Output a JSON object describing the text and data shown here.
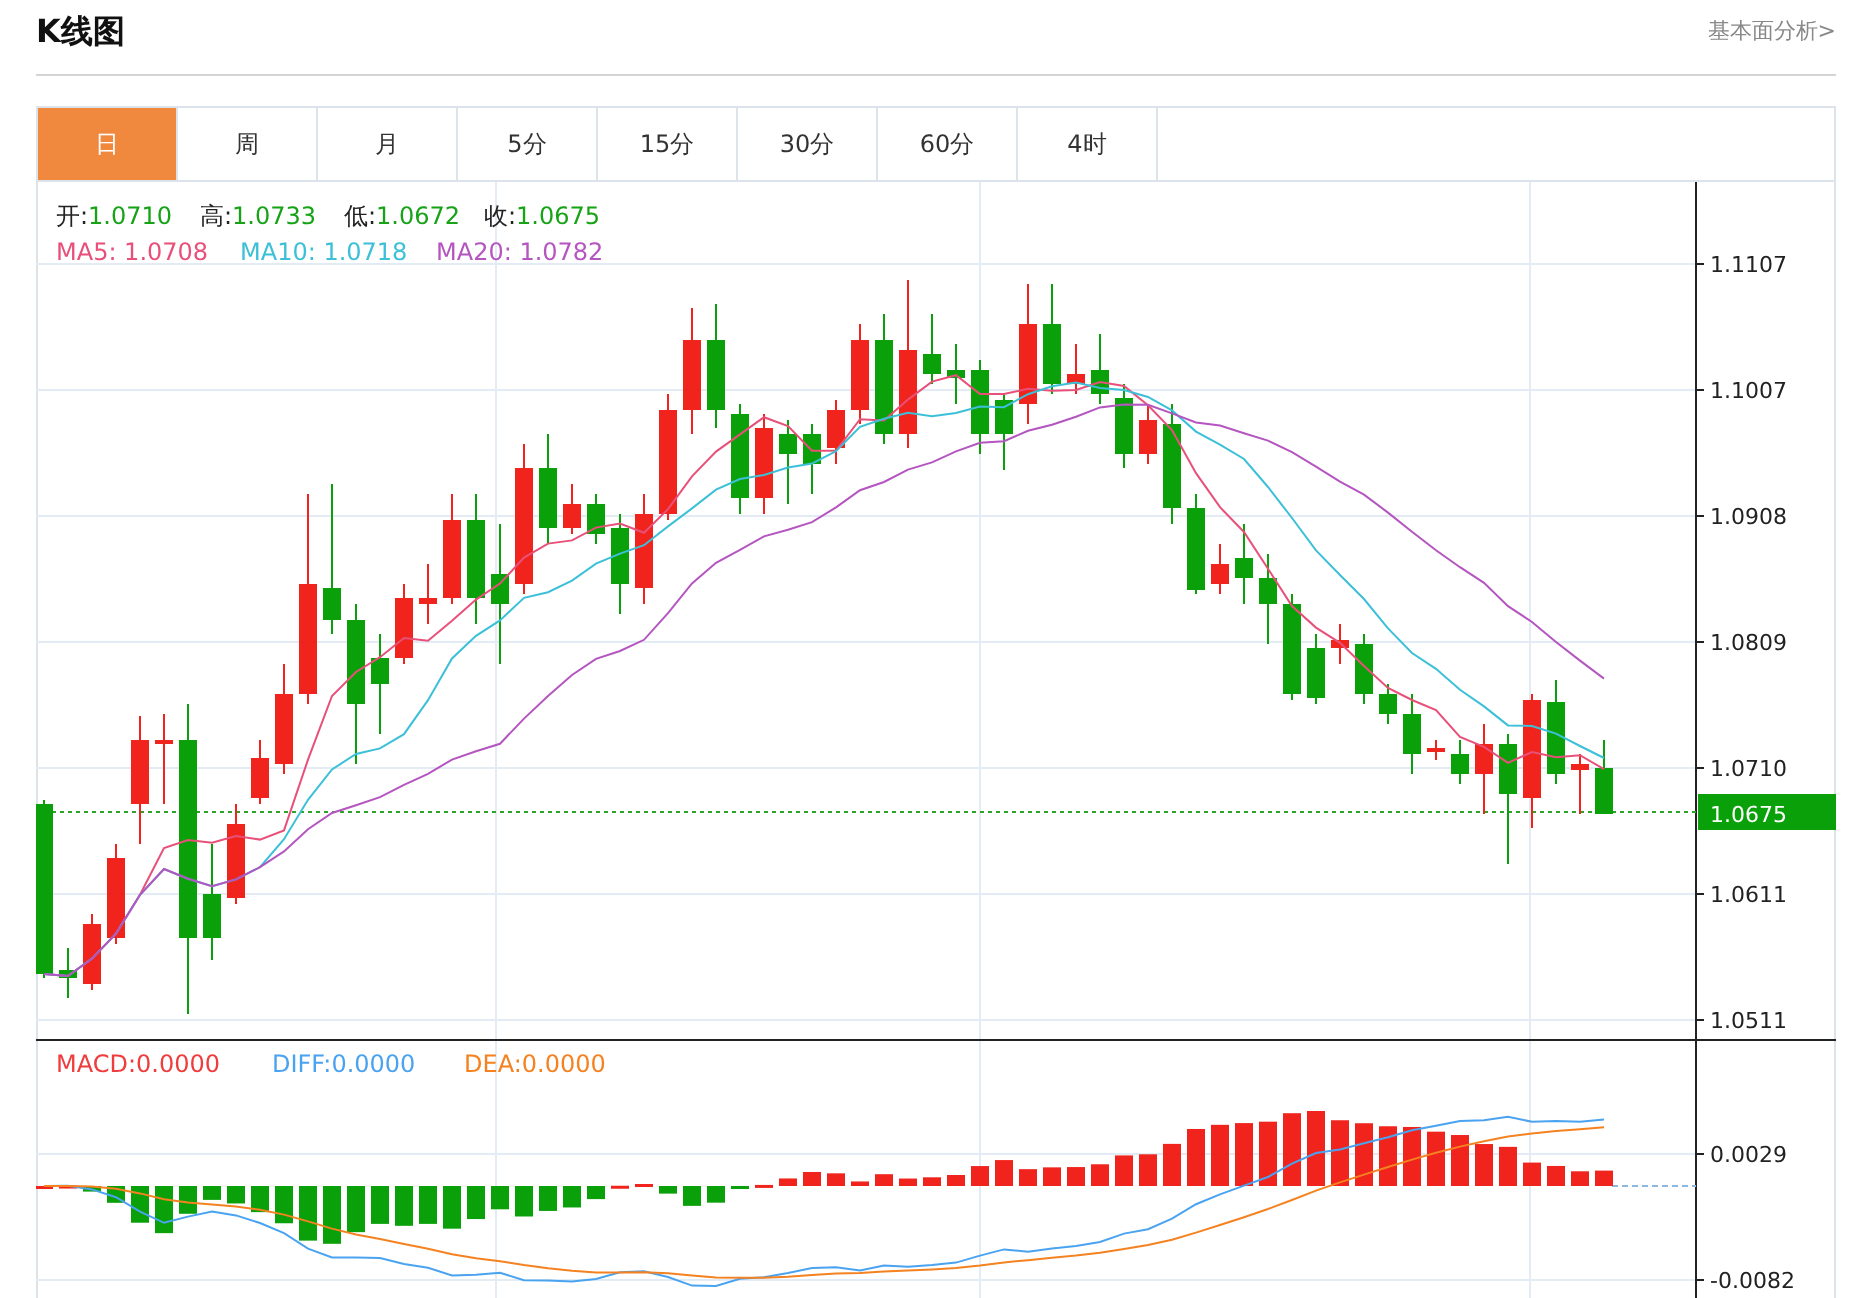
{
  "title": "K线图",
  "link": "基本面分析>",
  "tabs": [
    {
      "label": "日",
      "selected": true
    },
    {
      "label": "周",
      "selected": false
    },
    {
      "label": "月",
      "selected": false
    },
    {
      "label": "5分",
      "selected": false
    },
    {
      "label": "15分",
      "selected": false
    },
    {
      "label": "30分",
      "selected": false
    },
    {
      "label": "60分",
      "selected": false
    },
    {
      "label": "4时",
      "selected": false
    }
  ],
  "ohlc_legend": [
    {
      "label": "开:",
      "value": "1.0710"
    },
    {
      "label": "高:",
      "value": "1.0733"
    },
    {
      "label": "低:",
      "value": "1.0672"
    },
    {
      "label": "收:",
      "value": "1.0675"
    }
  ],
  "ma_legend": [
    {
      "label": "MA5:",
      "value": "1.0708",
      "color": "#e8507a"
    },
    {
      "label": "MA10:",
      "value": "1.0718",
      "color": "#3cc0d8"
    },
    {
      "label": "MA20:",
      "value": "1.0782",
      "color": "#b455c0"
    }
  ],
  "price_axis": [
    "1.1107",
    "1.1007",
    "1.0908",
    "1.0809",
    "1.0710",
    "1.0611",
    "1.0511"
  ],
  "current_price": "1.0675",
  "macd_legend": [
    {
      "label": "MACD:",
      "value": "0.0000",
      "color": "#f03c3c"
    },
    {
      "label": "DIFF:",
      "value": "0.0000",
      "color": "#4aa3f0"
    },
    {
      "label": "DEA:",
      "value": "0.0000",
      "color": "#f58220"
    }
  ],
  "macd_axis": [
    "0.0029",
    "-0.0082"
  ]
}
